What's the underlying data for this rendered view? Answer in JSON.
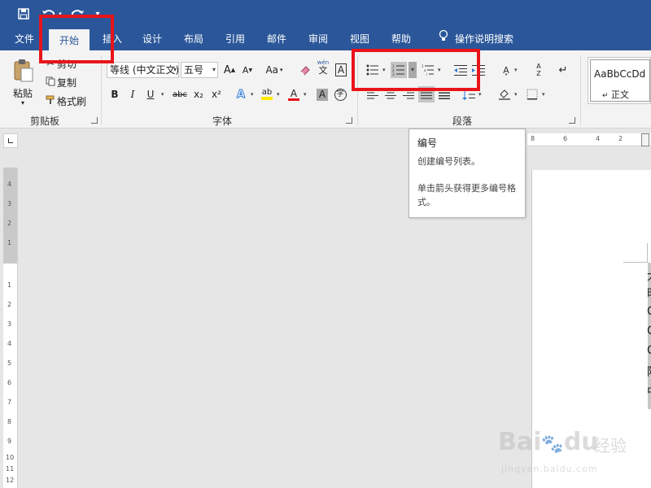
{
  "quick_access": {
    "save_icon": "save-icon",
    "undo_icon": "undo-icon",
    "redo_icon": "redo-icon",
    "customize_icon": "customize-qat-icon"
  },
  "tabs": [
    {
      "label": "文件"
    },
    {
      "label": "开始"
    },
    {
      "label": "插入"
    },
    {
      "label": "设计"
    },
    {
      "label": "布局"
    },
    {
      "label": "引用"
    },
    {
      "label": "邮件"
    },
    {
      "label": "审阅"
    },
    {
      "label": "视图"
    },
    {
      "label": "帮助"
    }
  ],
  "tell_me": {
    "label": "操作说明搜索",
    "icon": "lightbulb-icon"
  },
  "clipboard": {
    "paste_label": "粘贴",
    "cut_label": "剪切",
    "copy_label": "复制",
    "format_painter_label": "格式刷",
    "group_label": "剪贴板"
  },
  "font": {
    "family": "等线 (中文正文)",
    "size": "五号",
    "change_case": "Aa",
    "bold": "B",
    "italic": "I",
    "underline": "U",
    "strike": "abc",
    "subscript": "x₂",
    "superscript": "x²",
    "pinyin": "wén",
    "pinyin_char": "文",
    "char_border": "A",
    "text_effects": "A",
    "highlight": "ab",
    "font_color": "A",
    "char_shading": "A",
    "enclose": "字",
    "group_label": "字体"
  },
  "paragraph": {
    "group_label": "段落"
  },
  "styles": {
    "preview": "AaBbCcDd",
    "name": "正文"
  },
  "tooltip": {
    "title": "编号",
    "line1": "创建编号列表。",
    "line2": "单击箭头获得更多编号格式。"
  },
  "hruler_numbers": [
    "8",
    "6",
    "4",
    "2"
  ],
  "vruler_numbers": [
    "4",
    "3",
    "2",
    "1",
    "1",
    "2",
    "3",
    "4",
    "5",
    "6",
    "7",
    "8",
    "9",
    "10",
    "11",
    "12"
  ],
  "doc_chars": [
    "大",
    "明",
    "C",
    "C",
    "C",
    "阿",
    "中"
  ],
  "watermark": {
    "logo": "Bai",
    "logo2": "du",
    "cn": "经验",
    "url": "jingyan.baidu.com"
  },
  "colors": {
    "ribbon_blue": "#2b579a",
    "highlight_red": "#e8141a"
  }
}
